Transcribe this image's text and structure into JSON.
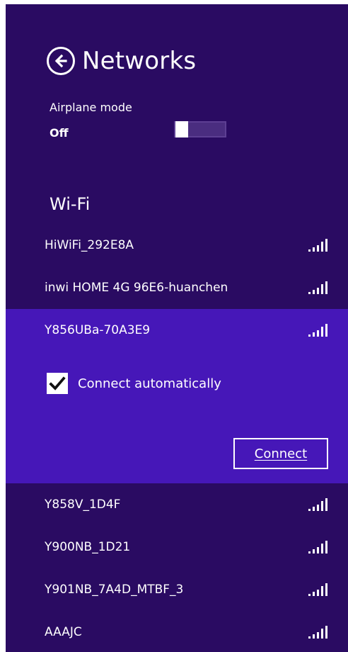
{
  "header": {
    "title": "Networks"
  },
  "airplane_mode": {
    "label": "Airplane mode",
    "state": "Off"
  },
  "wifi": {
    "heading": "Wi-Fi",
    "networks_top": [
      {
        "name": "HiWiFi_292E8A"
      },
      {
        "name": "inwi HOME 4G 96E6-huanchen"
      }
    ],
    "selected_network": {
      "name": "Y856UBa-70A3E9",
      "connect_automatically_label": "Connect automatically",
      "connect_automatically_checked": true,
      "connect_button_label": "Connect"
    },
    "networks_bottom": [
      {
        "name": "Y858V_1D4F"
      },
      {
        "name": "Y900NB_1D21"
      },
      {
        "name": "Y901NB_7A4D_MTBF_3"
      },
      {
        "name": "AAAJC"
      }
    ]
  },
  "colors": {
    "panel_bg": "#2a0b62",
    "selected_bg": "#4617b8",
    "toggle_track": "#4a2d80",
    "text": "#ffffff"
  },
  "icons": {
    "back": "back-arrow-circle-icon",
    "signal": "wifi-signal-bars-icon",
    "checkbox": "checkmark-icon"
  }
}
